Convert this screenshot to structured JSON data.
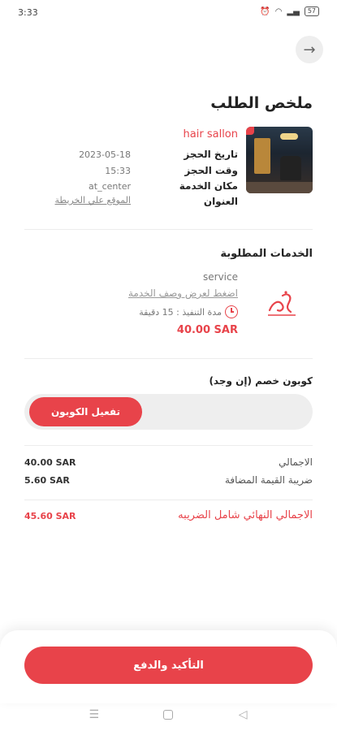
{
  "status_bar": {
    "time": "3:33",
    "battery": "57"
  },
  "header": {
    "title": "ملخص الطلب"
  },
  "booking": {
    "salon_name": "hair sallon",
    "rows": [
      {
        "label": "تاريخ الحجز",
        "value": "2023-05-18"
      },
      {
        "label": "وقت الحجز",
        "value": "15:33"
      },
      {
        "label": "مكان الخدمة",
        "value": "at_center"
      },
      {
        "label": "العنوان",
        "value": "الموقع علي الخريطة"
      }
    ]
  },
  "services": {
    "title": "الخدمات المطلوبة",
    "item": {
      "name": "service",
      "description_link": "اضغط لعرض وصف الخدمة",
      "duration": "مدة التنفيذ : 15 دقيقة",
      "price": "40.00 SAR"
    }
  },
  "coupon": {
    "title": "كوبون خصم (إن وجد)",
    "input_value": "",
    "button_label": "تفعيل الكوبون"
  },
  "summary": {
    "total_label": "الاجمالي",
    "total_value": "40.00 SAR",
    "vat_label": "ضريبة القيمة المضافة",
    "vat_value": "5.60 SAR",
    "grand_label": "الاجمالي النهائي شامل الضريبه",
    "grand_value": "45.60 SAR"
  },
  "footer": {
    "pay_button": "التأكيد والدفع"
  },
  "colors": {
    "accent": "#e8434a"
  }
}
